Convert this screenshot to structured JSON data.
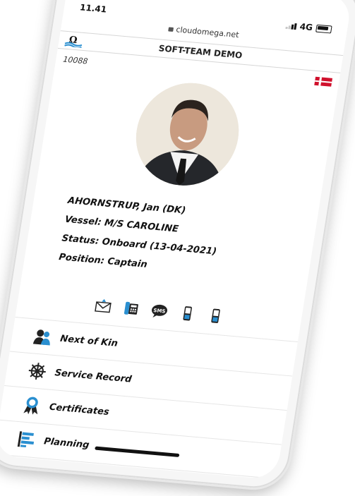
{
  "status_bar": {
    "time": "11.41",
    "network": "4G"
  },
  "browser": {
    "url": "cloudomega.net"
  },
  "app": {
    "title": "SOFT-TEAM DEMO"
  },
  "crew": {
    "id": "10088",
    "name": "AHORNSTRUP, Jan (DK)",
    "vessel": "Vessel: M/S CAROLINE",
    "status": "Status: Onboard (13-04-2021)",
    "position": "Position: Captain"
  },
  "contact_icons": [
    "email-icon",
    "phone-book-icon",
    "sms-icon",
    "mobile-phone-icon",
    "mobile-phone-icon"
  ],
  "menu": {
    "items": [
      {
        "label": "Next of Kin",
        "icon": "people-icon"
      },
      {
        "label": "Service Record",
        "icon": "ship-wheel-icon"
      },
      {
        "label": "Certificates",
        "icon": "award-ribbon-icon"
      },
      {
        "label": "Planning",
        "icon": "planning-chart-icon"
      }
    ]
  },
  "colors": {
    "accent": "#2a8fd0",
    "flag_red": "#d0102c"
  }
}
